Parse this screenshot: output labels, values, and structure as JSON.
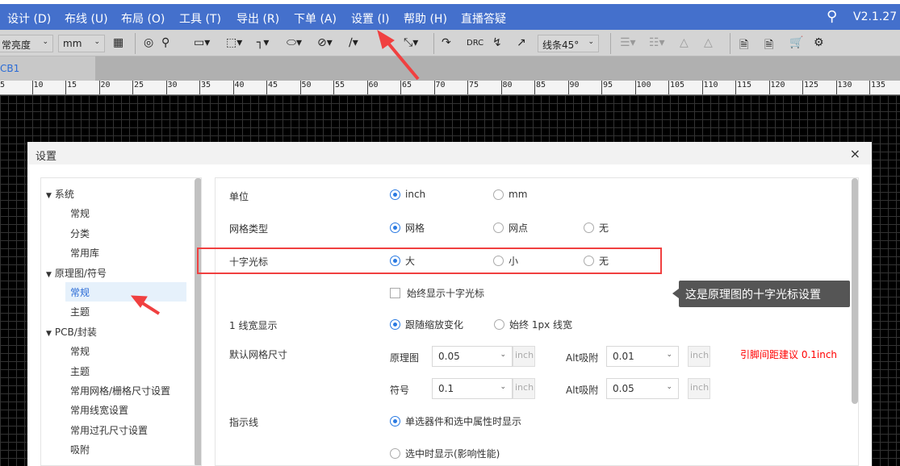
{
  "menu": {
    "items": [
      "设计 (D)",
      "布线 (U)",
      "布局 (O)",
      "工具 (T)",
      "导出 (R)",
      "下单 (A)",
      "设置 (I)",
      "帮助 (H)",
      "直播答疑"
    ],
    "version": "V2.1.27"
  },
  "toolbar": {
    "brightness": "常亮度",
    "unit": "mm",
    "line_mode": "线条45°",
    "drc": "DRC"
  },
  "tab": {
    "label": "CB1"
  },
  "ruler": [
    "5",
    "10",
    "15",
    "20",
    "25",
    "30",
    "35",
    "40",
    "45",
    "50",
    "55",
    "60",
    "65",
    "70",
    "75",
    "80",
    "85",
    "90",
    "95",
    "100",
    "105",
    "110",
    "115",
    "120",
    "125",
    "130",
    "135"
  ],
  "dialog": {
    "title": "设置",
    "close": "×"
  },
  "tree": [
    {
      "label": "系统",
      "level": 0
    },
    {
      "label": "常规",
      "level": 1
    },
    {
      "label": "分类",
      "level": 1
    },
    {
      "label": "常用库",
      "level": 1
    },
    {
      "label": "原理图/符号",
      "level": 0
    },
    {
      "label": "常规",
      "level": 1,
      "selected": true
    },
    {
      "label": "主题",
      "level": 1
    },
    {
      "label": "PCB/封装",
      "level": 0
    },
    {
      "label": "常规",
      "level": 1
    },
    {
      "label": "主题",
      "level": 1
    },
    {
      "label": "常用网格/栅格尺寸设置",
      "level": 1
    },
    {
      "label": "常用线宽设置",
      "level": 1
    },
    {
      "label": "常用过孔尺寸设置",
      "level": 1
    },
    {
      "label": "吸附",
      "level": 1
    }
  ],
  "settings": {
    "unit": {
      "label": "单位",
      "options": [
        "inch",
        "mm"
      ],
      "selected": 0
    },
    "grid_type": {
      "label": "网格类型",
      "options": [
        "网格",
        "网点",
        "无"
      ],
      "selected": 0
    },
    "crosshair": {
      "label": "十字光标",
      "options": [
        "大",
        "小",
        "无"
      ],
      "selected": 0
    },
    "always_crosshair": {
      "label": "始终显示十字光标",
      "checked": false
    },
    "line_width": {
      "label": "1 线宽显示",
      "options": [
        "跟随缩放变化",
        "始终 1px 线宽"
      ],
      "selected": 0
    },
    "grid_size": {
      "label": "默认网格尺寸",
      "schematic_label": "原理图",
      "schematic": "0.05",
      "symbol_label": "符号",
      "symbol": "0.1",
      "alt_label": "Alt吸附",
      "alt1": "0.01",
      "alt2": "0.05",
      "unit": "inch",
      "hint": "引脚间距建议 0.1inch"
    },
    "indicator": {
      "label": "指示线",
      "options": [
        "单选器件和选中属性时显示",
        "选中时显示(影响性能)"
      ],
      "selected": 0
    }
  },
  "tooltip": "这是原理图的十字光标设置",
  "colors": {
    "menubar": "#4470cc",
    "accent": "#2a7ae2",
    "highlight": "#f04040",
    "hint": "#ff0000"
  }
}
